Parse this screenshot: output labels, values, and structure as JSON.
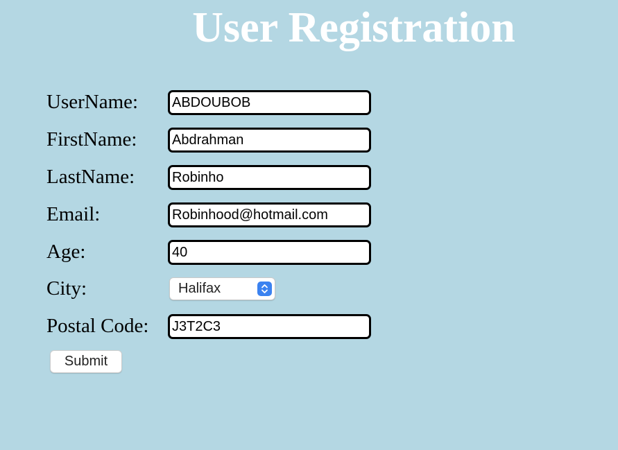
{
  "page": {
    "title": "User Registration",
    "background_color": "#b4d7e3",
    "title_color": "#ffffff"
  },
  "form": {
    "username": {
      "label": "UserName:",
      "value": "ABDOUBOB"
    },
    "firstname": {
      "label": "FirstName:",
      "value": "Abdrahman"
    },
    "lastname": {
      "label": "LastName:",
      "value": "Robinho"
    },
    "email": {
      "label": "Email:",
      "value": "Robinhood@hotmail.com"
    },
    "age": {
      "label": "Age:",
      "value": "40"
    },
    "city": {
      "label": "City:",
      "selected": "Halifax",
      "icon": "select-arrows-icon",
      "accent_color": "#3b82f0"
    },
    "postal_code": {
      "label": "Postal Code:",
      "value": "J3T2C3"
    },
    "submit_label": "Submit"
  }
}
